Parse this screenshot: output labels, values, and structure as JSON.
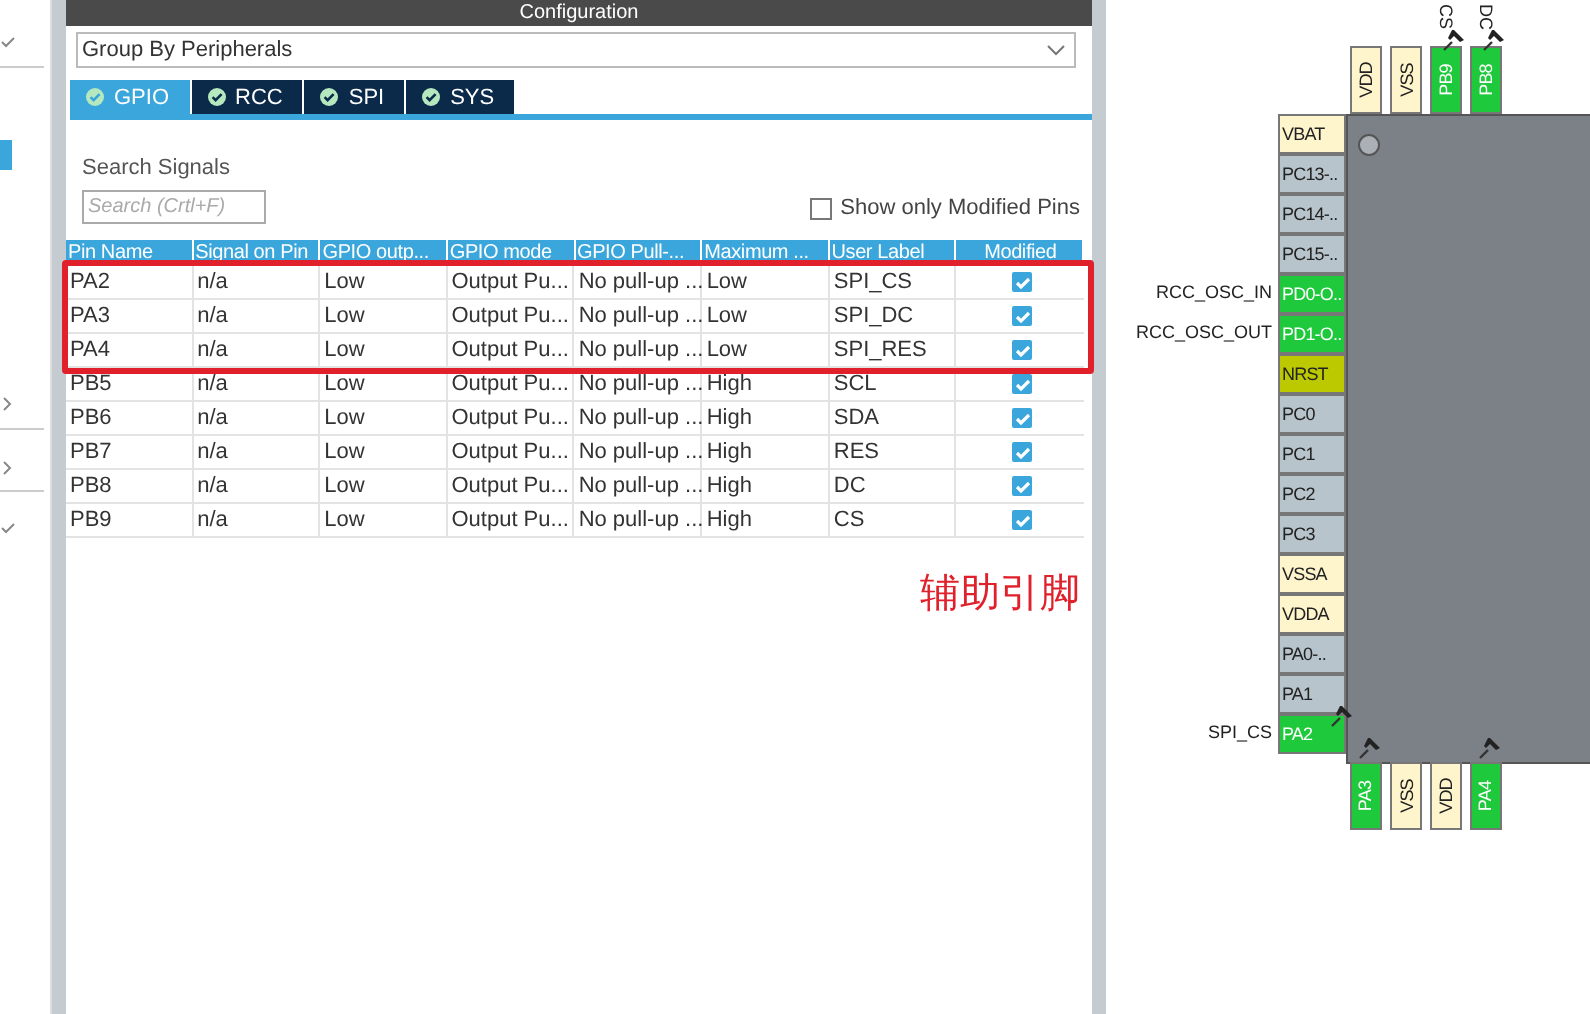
{
  "panel": {
    "title": "Configuration"
  },
  "group_by": {
    "value": "Group By Peripherals"
  },
  "tabs": [
    {
      "label": "GPIO",
      "selected": true
    },
    {
      "label": "RCC",
      "selected": false
    },
    {
      "label": "SPI",
      "selected": false
    },
    {
      "label": "SYS",
      "selected": false
    }
  ],
  "search": {
    "label": "Search Signals",
    "placeholder": "Search (Crtl+F)"
  },
  "show_modified": {
    "label": "Show only Modified Pins",
    "checked": false
  },
  "table": {
    "columns": [
      "Pin Name",
      "Signal on Pin",
      "GPIO outp...",
      "GPIO mode",
      "GPIO Pull-...",
      "Maximum ...",
      "User Label",
      "Modified"
    ],
    "rows": [
      {
        "cells": [
          "PA2",
          "n/a",
          "Low",
          "Output Pu...",
          "No pull-up ...",
          "Low",
          "SPI_CS"
        ],
        "modified": true,
        "highlighted": true
      },
      {
        "cells": [
          "PA3",
          "n/a",
          "Low",
          "Output Pu...",
          "No pull-up ...",
          "Low",
          "SPI_DC"
        ],
        "modified": true,
        "highlighted": true
      },
      {
        "cells": [
          "PA4",
          "n/a",
          "Low",
          "Output Pu...",
          "No pull-up ...",
          "Low",
          "SPI_RES"
        ],
        "modified": true,
        "highlighted": true
      },
      {
        "cells": [
          "PB5",
          "n/a",
          "Low",
          "Output Pu...",
          "No pull-up ...",
          "High",
          "SCL"
        ],
        "modified": true
      },
      {
        "cells": [
          "PB6",
          "n/a",
          "Low",
          "Output Pu...",
          "No pull-up ...",
          "High",
          "SDA"
        ],
        "modified": true
      },
      {
        "cells": [
          "PB7",
          "n/a",
          "Low",
          "Output Pu...",
          "No pull-up ...",
          "High",
          "RES"
        ],
        "modified": true
      },
      {
        "cells": [
          "PB8",
          "n/a",
          "Low",
          "Output Pu...",
          "No pull-up ...",
          "High",
          "DC"
        ],
        "modified": true
      },
      {
        "cells": [
          "PB9",
          "n/a",
          "Low",
          "Output Pu...",
          "No pull-up ...",
          "High",
          "CS"
        ],
        "modified": true
      }
    ]
  },
  "annotation": {
    "text": "辅助引脚"
  },
  "chip": {
    "top_pins": [
      {
        "name": "VDD",
        "color": "#fff5cc"
      },
      {
        "name": "VSS",
        "color": "#fff5cc"
      },
      {
        "name": "PB9",
        "color": "#1fc93c",
        "label": "CS",
        "pinned": true
      },
      {
        "name": "PB8",
        "color": "#1fc93c",
        "label": "DC",
        "pinned": true
      }
    ],
    "left_pins": [
      {
        "name": "VBAT",
        "color": "#fff5cc"
      },
      {
        "name": "PC13-..",
        "color": "#b8c4cc"
      },
      {
        "name": "PC14-..",
        "color": "#b8c4cc"
      },
      {
        "name": "PC15-..",
        "color": "#b8c4cc"
      },
      {
        "name": "PD0-O..",
        "color": "#1fc93c",
        "label": "RCC_OSC_IN"
      },
      {
        "name": "PD1-O..",
        "color": "#1fc93c",
        "label": "RCC_OSC_OUT"
      },
      {
        "name": "NRST",
        "color": "#bcc800"
      },
      {
        "name": "PC0",
        "color": "#b8c4cc"
      },
      {
        "name": "PC1",
        "color": "#b8c4cc"
      },
      {
        "name": "PC2",
        "color": "#b8c4cc"
      },
      {
        "name": "PC3",
        "color": "#b8c4cc"
      },
      {
        "name": "VSSA",
        "color": "#fff5cc"
      },
      {
        "name": "VDDA",
        "color": "#fff5cc"
      },
      {
        "name": "PA0-..",
        "color": "#b8c4cc"
      },
      {
        "name": "PA1",
        "color": "#b8c4cc"
      },
      {
        "name": "PA2",
        "color": "#1fc93c",
        "label": "SPI_CS",
        "pinned": true
      }
    ],
    "bottom_pins": [
      {
        "name": "PA3",
        "color": "#1fc93c",
        "pinned": true
      },
      {
        "name": "VSS",
        "color": "#fff5cc"
      },
      {
        "name": "VDD",
        "color": "#fff5cc"
      },
      {
        "name": "PA4",
        "color": "#1fc93c",
        "pinned": true
      }
    ]
  }
}
